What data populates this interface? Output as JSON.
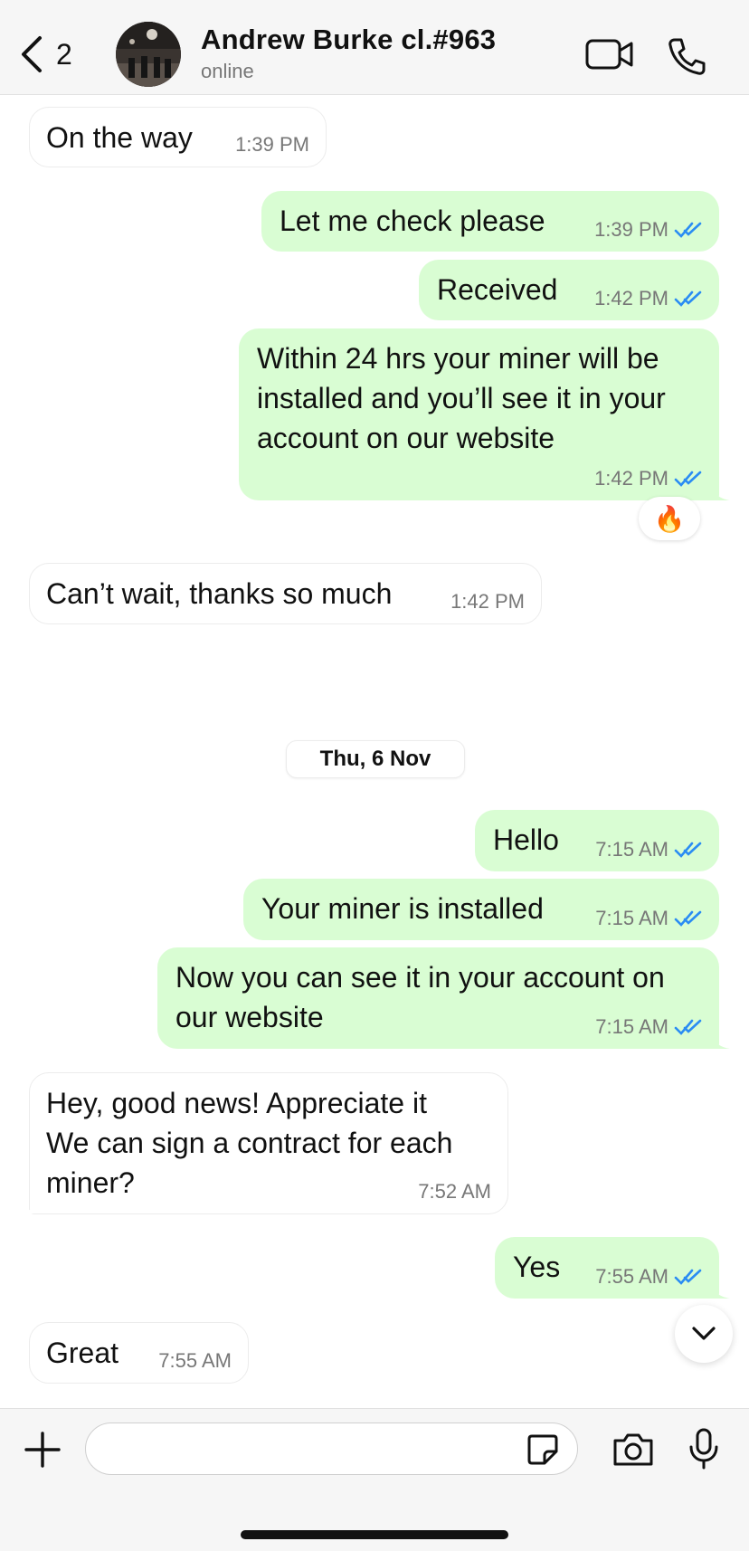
{
  "header": {
    "back_count": "2",
    "contact_name": "Andrew Burke cl.#963",
    "status": "online"
  },
  "messages": [
    {
      "dir": "in",
      "text": "On the way",
      "time": "1:39 PM"
    },
    {
      "dir": "out",
      "text": "Let me check please",
      "time": "1:39 PM"
    },
    {
      "dir": "out",
      "text": "Received",
      "time": "1:42 PM"
    },
    {
      "dir": "out",
      "text": "Within 24 hrs your miner will be installed and you’ll see it in your account on our website",
      "time": "1:42 PM",
      "reaction": "🔥"
    },
    {
      "dir": "in",
      "text": "Can’t wait, thanks so much",
      "time": "1:42 PM"
    },
    {
      "dir": "out",
      "text": "Hello",
      "time": "7:15 AM"
    },
    {
      "dir": "out",
      "text": "Your miner is installed",
      "time": "7:15 AM"
    },
    {
      "dir": "out",
      "text": "Now you can see it in your account on our website",
      "time": "7:15 AM"
    },
    {
      "dir": "in",
      "text": "Hey, good news! Appreciate it\nWe can sign a contract for each miner?",
      "time": "7:52 AM"
    },
    {
      "dir": "out",
      "text": "Yes",
      "time": "7:55 AM"
    },
    {
      "dir": "in",
      "text": "Great",
      "time": "7:55 AM"
    }
  ],
  "date_separator": "Thu, 6 Nov",
  "composer": {
    "placeholder": ""
  },
  "colors": {
    "outgoing_bubble": "#d9fdd3",
    "incoming_bubble": "#ffffff",
    "read_ticks": "#2a8cf3"
  },
  "icons": [
    "back-chevron-icon",
    "video-call-icon",
    "phone-call-icon",
    "fire-emoji",
    "chevron-down-icon",
    "plus-icon",
    "sticker-icon",
    "camera-icon",
    "microphone-icon"
  ]
}
